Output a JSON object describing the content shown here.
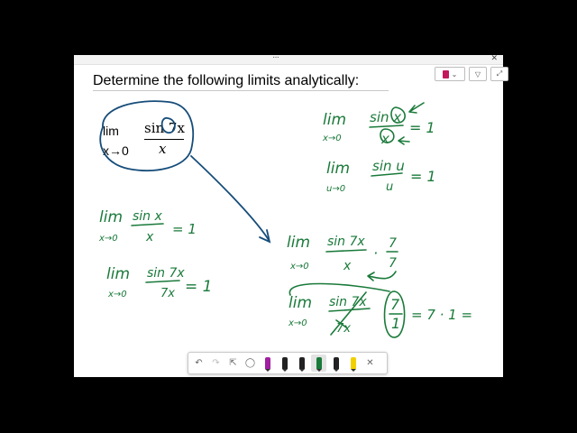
{
  "window": {
    "title_dots": "···",
    "close_label": "✕"
  },
  "heading": "Determine the following limits analytically:",
  "top_tools": {
    "notebook_chevron": "⌄",
    "filter_label": "▽",
    "expand_label": "⤢"
  },
  "typed_equation": {
    "lim_label": "lim",
    "subscript": "x→0",
    "numerator": "sin 7x",
    "denominator": "x"
  },
  "handwriting": {
    "ink_color": "#1a7a3a",
    "circle_color": "#164d7a",
    "ref1": [
      "lim",
      "x→0",
      "sin x",
      "x",
      "= 1"
    ],
    "ref2": [
      "lim",
      "u→0",
      "sin u",
      "u",
      "= 1"
    ],
    "left1": [
      "lim",
      "x→0",
      "sin x",
      "x",
      "= 1"
    ],
    "left2": [
      "lim",
      "x→0",
      "sin 7x",
      "7x",
      "= 1"
    ],
    "right1": [
      "lim",
      "x→0",
      "sin 7x",
      "x",
      "·",
      "7",
      "7"
    ],
    "right2": [
      "lim",
      "x→0",
      "sin 7x",
      "7x",
      "7",
      "1",
      "= 7 · 1 ="
    ]
  },
  "toolbar": {
    "undo": "↶",
    "redo": "↷",
    "select": "⇱",
    "lasso": "◯",
    "close": "✕",
    "pens": [
      "#a020a0",
      "#222222",
      "#222222",
      "#1a7a3a",
      "#222222",
      "#f2d000"
    ]
  }
}
